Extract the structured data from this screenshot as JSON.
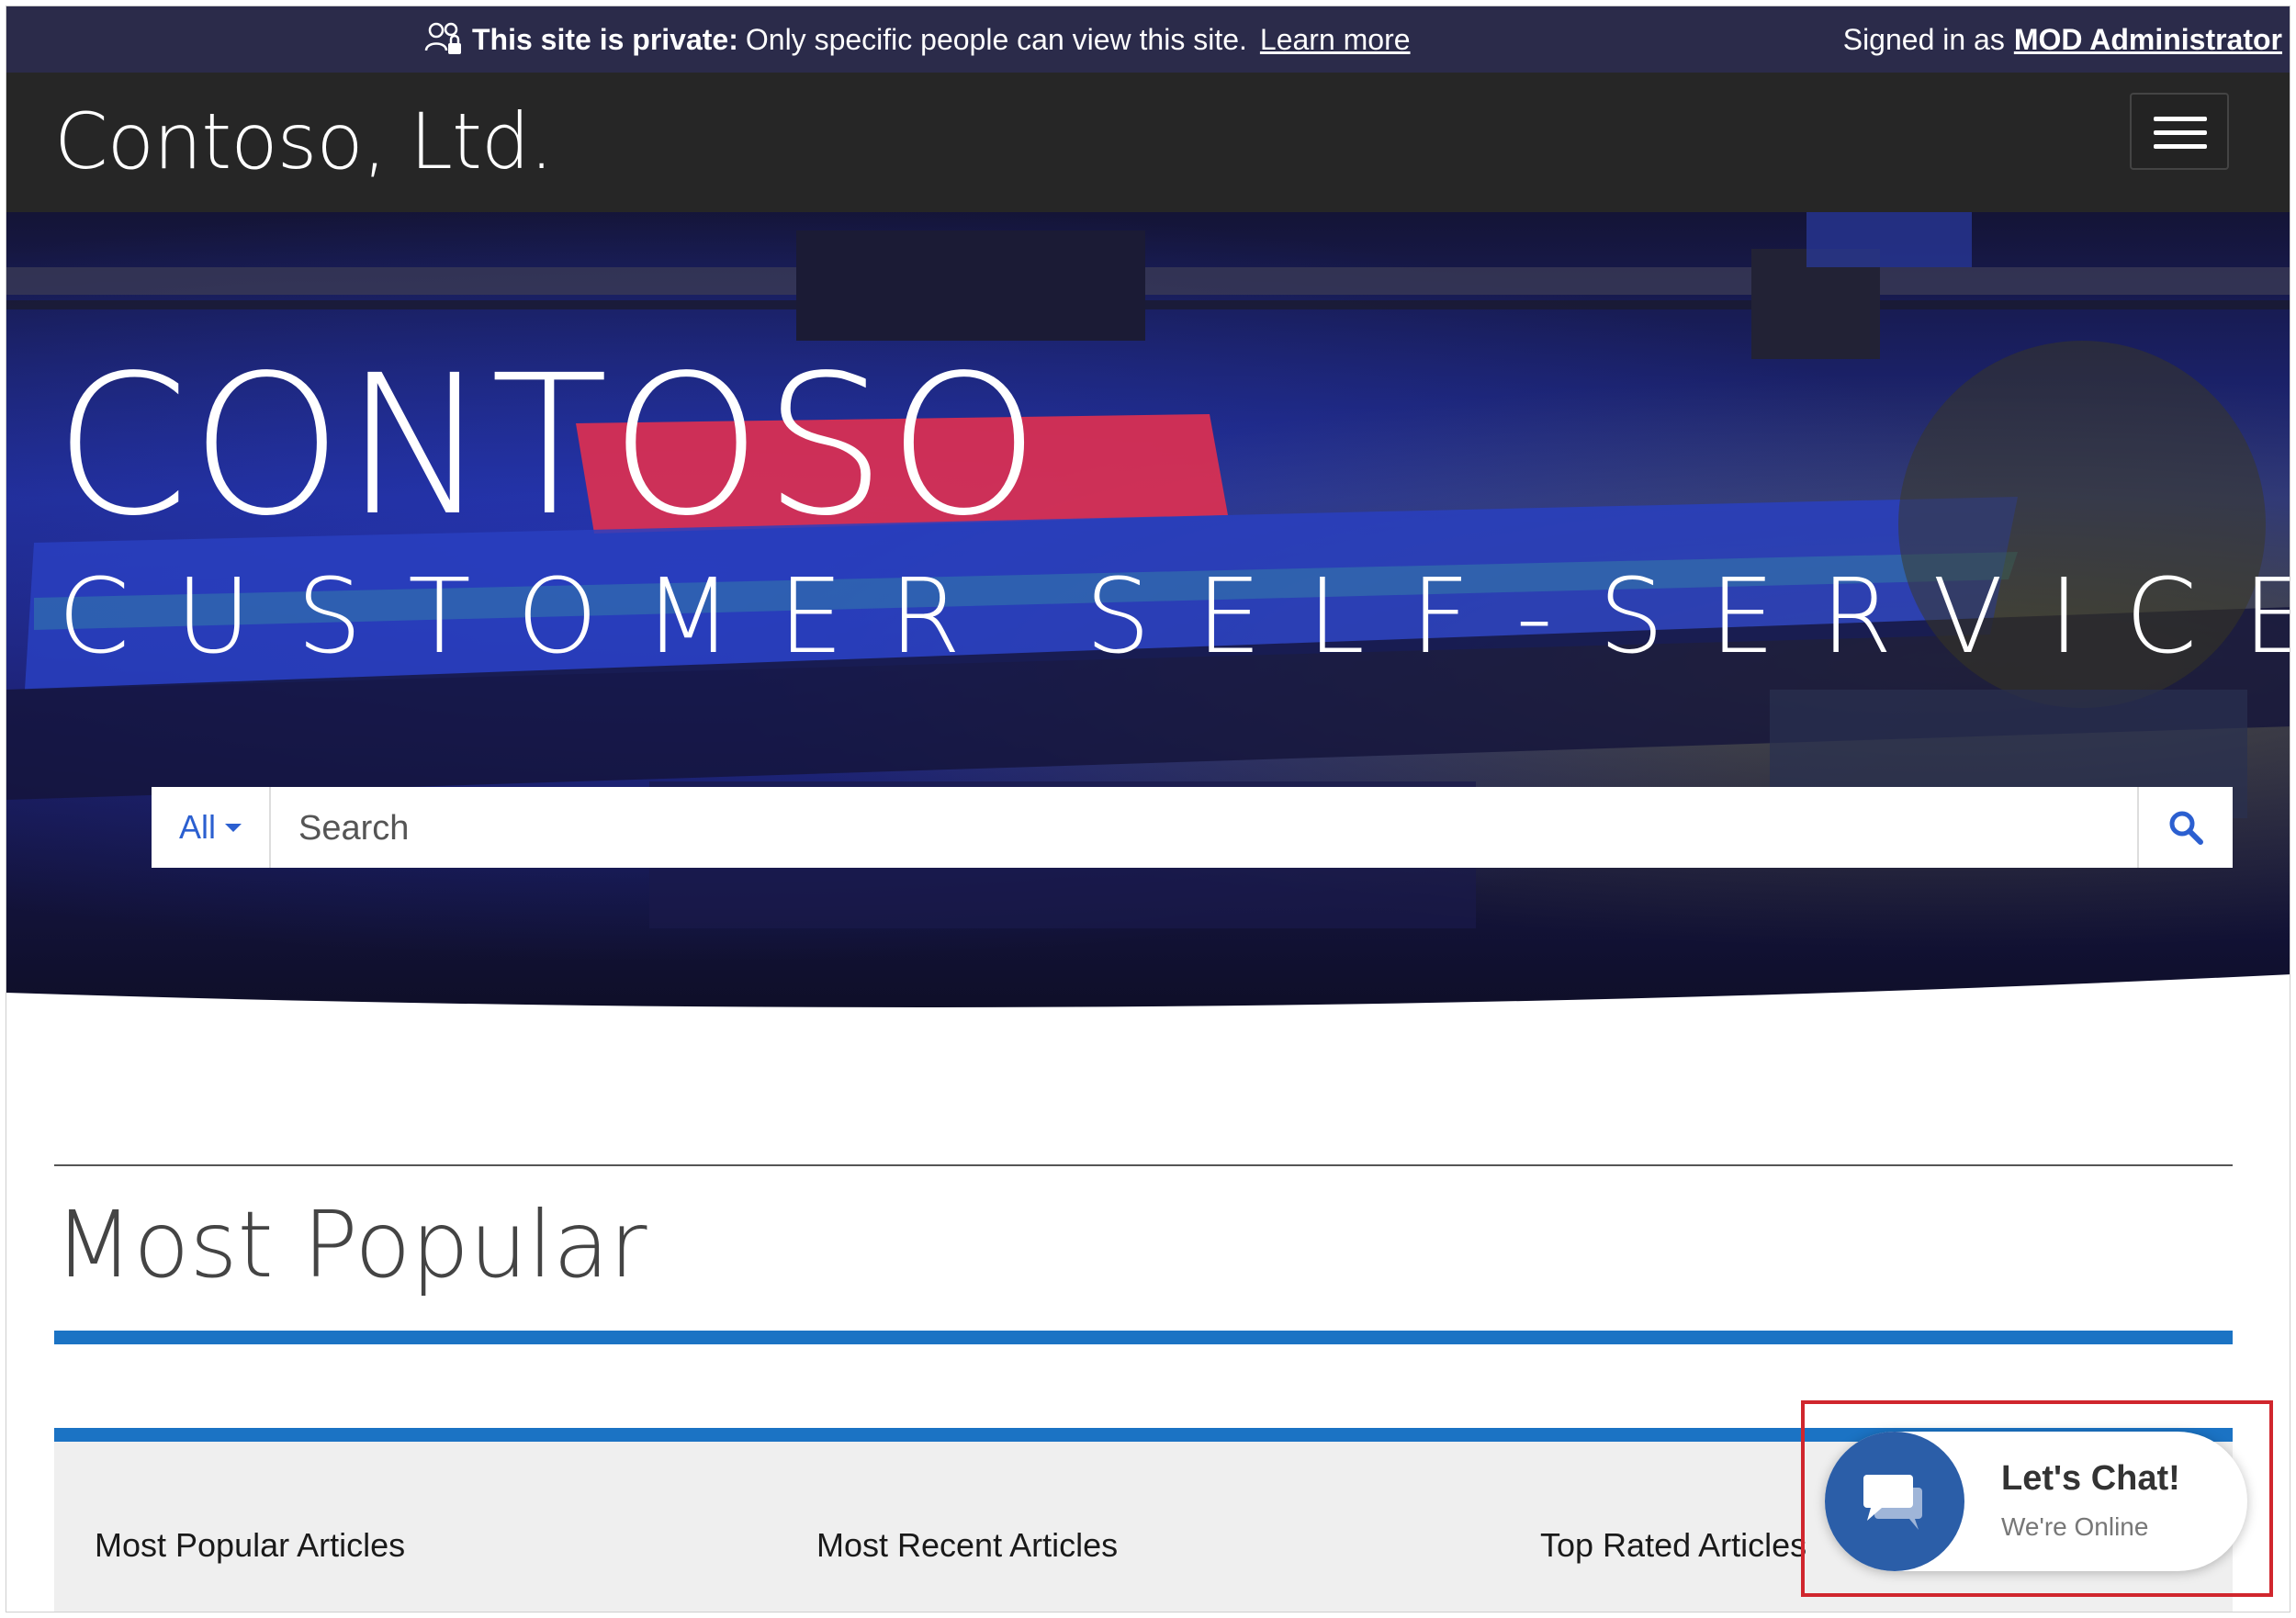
{
  "banner": {
    "private_strong": "This site is private:",
    "private_text": "Only specific people can view this site.",
    "learn_more": "Learn more",
    "signed_in_label": "Signed in as",
    "user_name": "MOD Administrator"
  },
  "header": {
    "brand": "Contoso, Ltd.",
    "menu_icon": "hamburger-icon"
  },
  "hero": {
    "title": "CONTOSO",
    "subtitle": "CUSTOMER SELF-SERVICE",
    "search": {
      "scope": "All",
      "placeholder": "Search",
      "button_icon": "search-icon"
    }
  },
  "content": {
    "section_title": "Most Popular",
    "tabs": [
      {
        "label": "Most Popular Articles"
      },
      {
        "label": "Most Recent Articles"
      },
      {
        "label": "Top Rated Articles"
      }
    ]
  },
  "chat": {
    "title": "Let's Chat!",
    "status": "We're Online",
    "icon": "chat-bubble-icon"
  },
  "colors": {
    "banner_bg": "#2b2b4a",
    "navbar_bg": "#262626",
    "accent_blue": "#1b73c4",
    "link_blue": "#2b5fd0",
    "chat_blue": "#2b5ea8",
    "highlight_red": "#d0262d"
  }
}
